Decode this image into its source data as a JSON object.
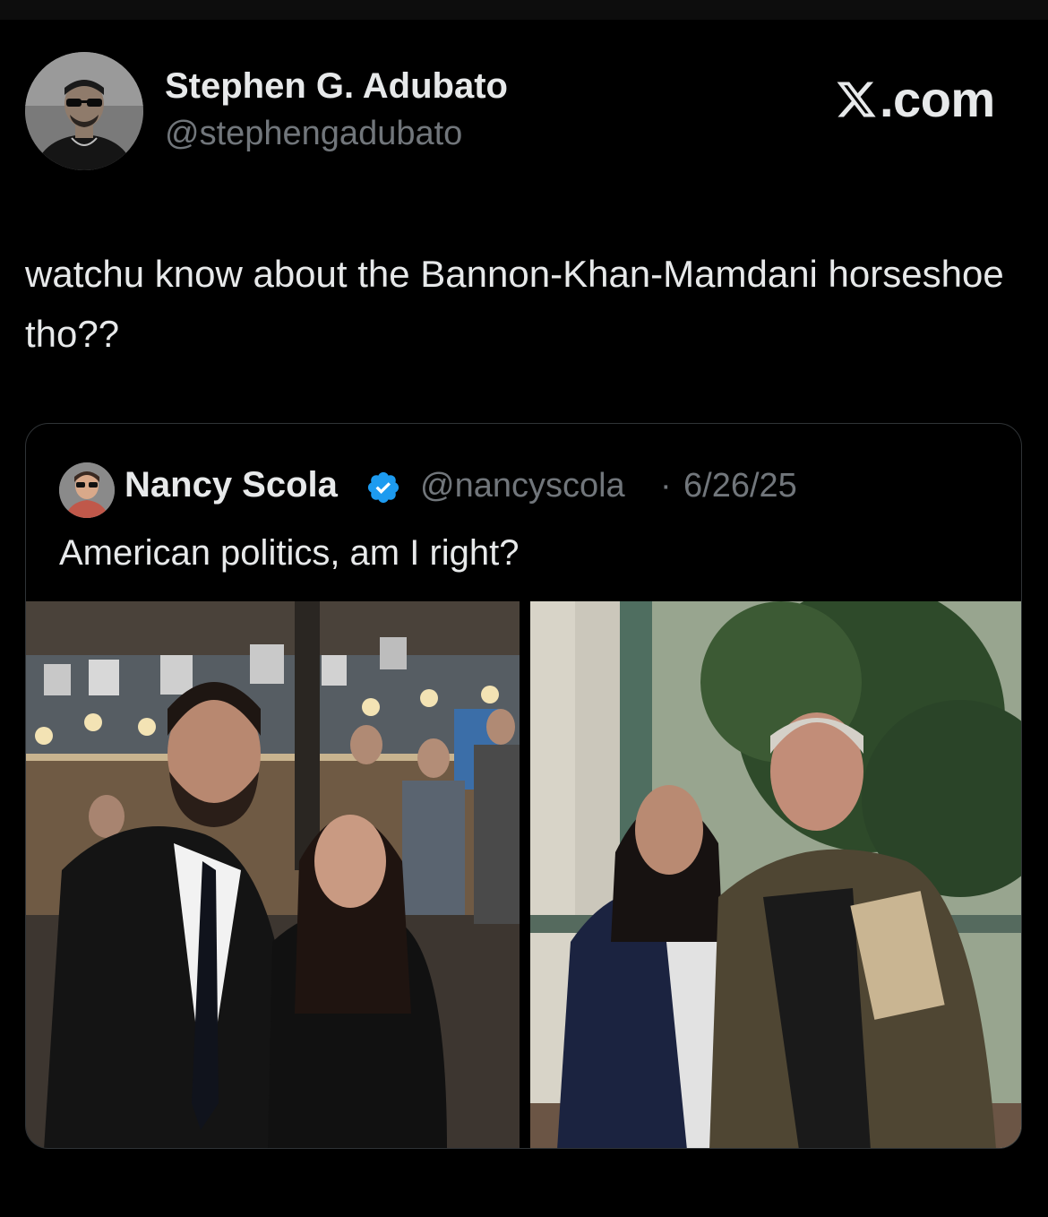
{
  "post": {
    "author_name": "Stephen G. Adubato",
    "author_handle": "@stephengadubato",
    "logo_text": ".com",
    "text": "watchu know about the Bannon-Khan-Mamdani horseshoe tho??"
  },
  "quoted": {
    "author_name": "Nancy Scola",
    "author_handle": "@nancyscola",
    "separator": "·",
    "date": "6/26/25",
    "text": "American politics, am I right?",
    "verified_color": "#1d9bf0"
  },
  "icons": {
    "logo": "x-logo-icon",
    "verified": "verified-badge-icon"
  },
  "colors": {
    "background": "#000000",
    "primary_text": "#e7e9ea",
    "secondary_text": "#71767b",
    "border": "#2f3336"
  }
}
